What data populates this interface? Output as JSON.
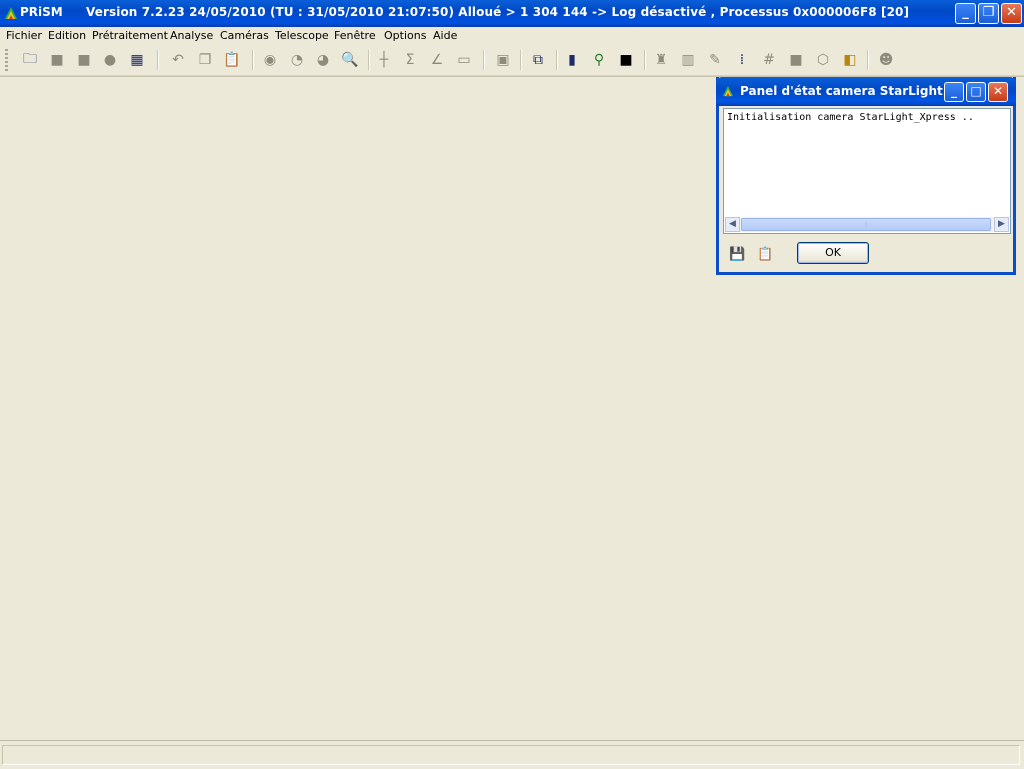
{
  "window": {
    "app_name": "PRiSM",
    "title": "Version 7.2.23   24/05/2010   (TU : 31/05/2010 21:07:50) Alloué > 1 304 144 -> Log désactivé , Processus 0x000006F8 [20]",
    "controls": {
      "minimize": "_",
      "restore": "❐",
      "close": "✕"
    }
  },
  "menu": {
    "items": [
      "Fichier",
      "Edition",
      "Prétraitement",
      "Analyse",
      "Caméras",
      "Telescope",
      "Fenêtre",
      "Options",
      "Aide"
    ]
  },
  "toolbar": {
    "icons": [
      "open-icon",
      "disabled-icon",
      "disabled-icon",
      "info-icon",
      "calendar-icon",
      "undo-icon",
      "copy-icon",
      "paste-icon",
      "zoom-in-icon",
      "zoom-out-icon",
      "zoom-icon",
      "magnify-icon",
      "crosshair-icon",
      "sum-icon",
      "angle-icon",
      "rectangle-icon",
      "archive-icon",
      "camera-control-icon",
      "telescope-icon",
      "telescope-mount-icon",
      "star-chart-icon",
      "observatory-icon",
      "bars-icon",
      "pen-icon",
      "network-icon",
      "grid-icon",
      "square-icon",
      "hexagon-icon",
      "filter-icon",
      "face-icon"
    ]
  },
  "dialog": {
    "title": "Panel d'état camera StarLight...",
    "log_text": "Initialisation camera StarLight_Xpress ..",
    "ok_label": "OK",
    "icons": [
      "save-icon",
      "clipboard-icon"
    ]
  }
}
